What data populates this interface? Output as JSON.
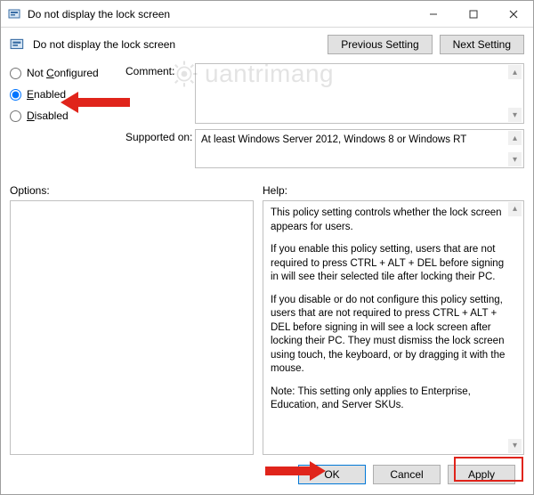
{
  "titlebar": {
    "title": "Do not display the lock screen"
  },
  "header": {
    "title": "Do not display the lock screen",
    "prev_label": "Previous Setting",
    "next_label": "Next Setting"
  },
  "radios": {
    "not_configured": "Not Configured",
    "enabled": "Enabled",
    "disabled": "Disabled"
  },
  "fields": {
    "comment_label": "Comment:",
    "supported_label": "Supported on:",
    "supported_text": "At least Windows Server 2012, Windows 8 or Windows RT"
  },
  "labels": {
    "options": "Options:",
    "help": "Help:"
  },
  "help": {
    "p1": "This policy setting controls whether the lock screen appears for users.",
    "p2": "If you enable this policy setting, users that are not required to press CTRL + ALT + DEL before signing in will see their selected tile after locking their PC.",
    "p3": "If you disable or do not configure this policy setting, users that are not required to press CTRL + ALT + DEL before signing in will see a lock screen after locking their PC. They must dismiss the lock screen using touch, the keyboard, or by dragging it with the mouse.",
    "p4": "Note: This setting only applies to Enterprise, Education, and Server SKUs."
  },
  "footer": {
    "ok": "OK",
    "cancel": "Cancel",
    "apply": "Apply"
  },
  "watermark": {
    "text": "uantrimang"
  }
}
